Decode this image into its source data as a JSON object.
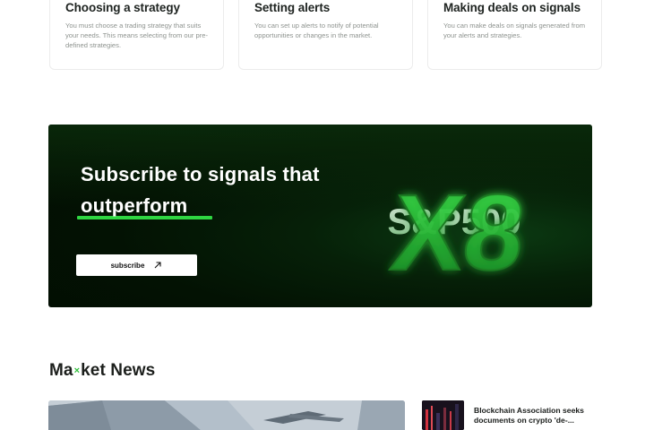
{
  "features": [
    {
      "title": "Choosing a strategy",
      "description": "You must choose a trading strategy that suits your needs. This means selecting from our pre-defined strategies."
    },
    {
      "title": "Setting alerts",
      "description": "You can set up alerts to notify of potential opportunities or changes in the market."
    },
    {
      "title": "Making deals on signals",
      "description": "You can make deals on signals generated from your alerts and strategies."
    }
  ],
  "banner": {
    "title_line1": "Subscribe to signals that",
    "title_line2": "outperform",
    "button_label": "subscribe",
    "graphic_text_back": "S&P500",
    "graphic_text_front": "X8",
    "accent_color": "#2fd642",
    "background_color": "#031203"
  },
  "news": {
    "heading_prefix": "Ma",
    "heading_mark": "×",
    "heading_suffix": "ket News",
    "items": [
      {
        "title": "Blockchain Association seeks documents on crypto 'de-..."
      }
    ]
  }
}
